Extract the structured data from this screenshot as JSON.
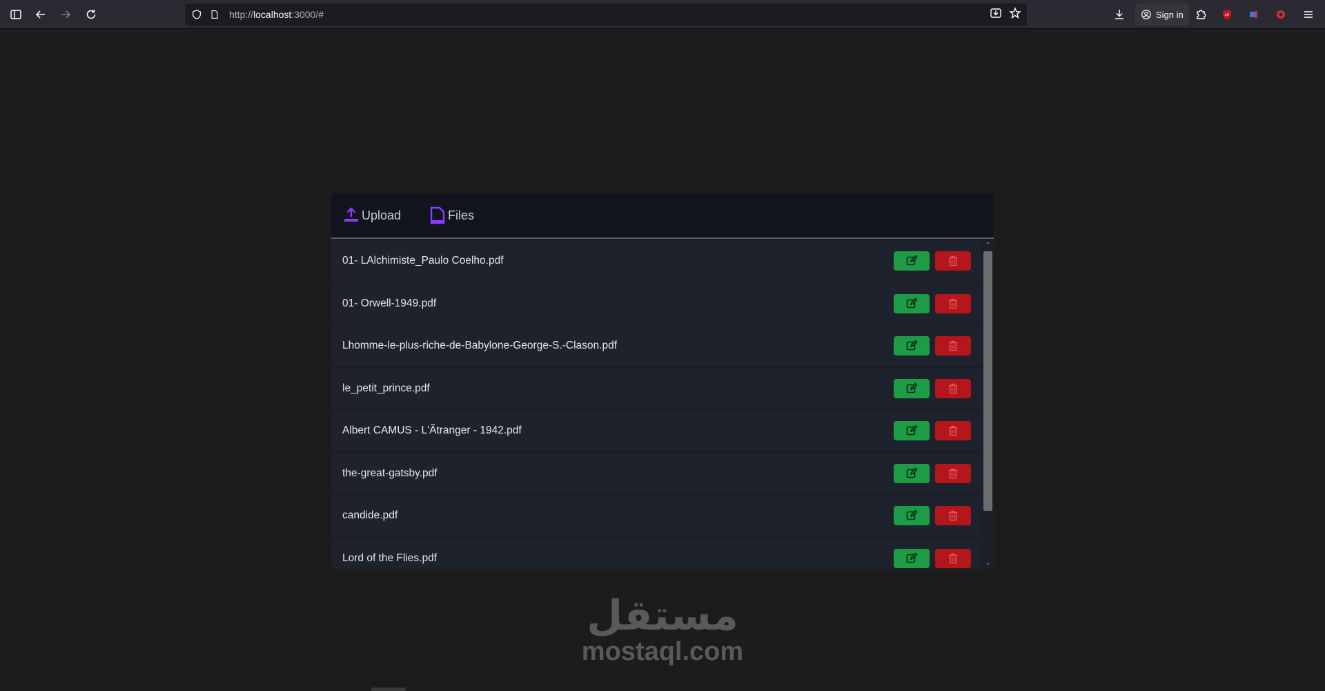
{
  "browser": {
    "url_prefix": "http://",
    "url_host": "localhost",
    "url_suffix": ":3000/#",
    "sign_in_label": "Sign in"
  },
  "app": {
    "nav": [
      {
        "label": "Upload",
        "icon": "upload-icon"
      },
      {
        "label": "Files",
        "icon": "file-icon"
      }
    ],
    "files": [
      "01- LAlchimiste_Paulo Coelho.pdf",
      "01- Orwell-1949.pdf",
      "Lhomme-le-plus-riche-de-Babylone-George-S.-Clason.pdf",
      "le_petit_prince.pdf",
      "Albert CAMUS - L'Ãtranger - 1942.pdf",
      "the-great-gatsby.pdf",
      "candide.pdf",
      "Lord of the Flies.pdf"
    ],
    "colors": {
      "edit": "#1e9b45",
      "delete": "#b5161b",
      "accent": "#7c3aed"
    }
  },
  "watermark": {
    "arabic": "مستقل",
    "latin": "mostaql.com"
  }
}
